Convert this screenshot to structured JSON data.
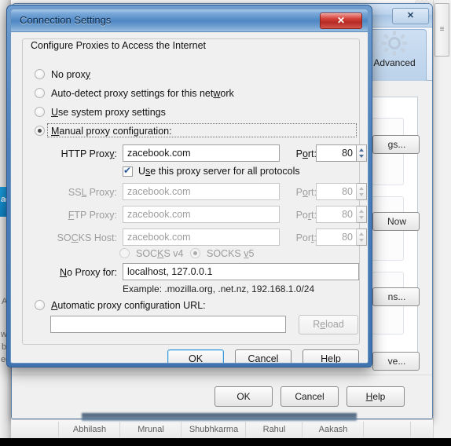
{
  "background_window": {
    "close_label": "✕",
    "tab": {
      "label": "Advanced",
      "icon": "gear-icon"
    },
    "partial_buttons": [
      {
        "name": "settings-button",
        "label": "gs..."
      },
      {
        "name": "check-now-button",
        "label": "Now"
      },
      {
        "name": "exceptions-button",
        "label": "ns..."
      },
      {
        "name": "remove-button",
        "label": "ve..."
      }
    ],
    "footer_buttons": [
      {
        "name": "ok-button",
        "label": "OK"
      },
      {
        "name": "cancel-button",
        "label": "Cancel"
      },
      {
        "name": "help-button",
        "label": "Help",
        "accel": "H"
      }
    ]
  },
  "page_behind": {
    "tab_text": "ac",
    "faint_lines": [
      "A",
      "wh",
      "b",
      "ed"
    ]
  },
  "chatbar": {
    "items": [
      "Abhilash",
      "Mrunal",
      "Shubhkarma",
      "Rahul",
      "Aakash"
    ]
  },
  "dialog": {
    "title": "Connection Settings",
    "close_label": "✕",
    "group_title": "Configure Proxies to Access the Internet",
    "proxy_modes": [
      {
        "label": "No proxy",
        "accel": "y",
        "selected": false
      },
      {
        "label": "Auto-detect proxy settings for this network",
        "accel": "w",
        "selected": false
      },
      {
        "label": "Use system proxy settings",
        "accel": "U",
        "selected": false
      },
      {
        "label": "Manual proxy configuration:",
        "accel": "M",
        "selected": true
      }
    ],
    "fields": [
      {
        "name": "http-proxy",
        "label": "HTTP Proxy:",
        "value": "zacebook.com",
        "port_label": "Port:",
        "port": "80",
        "disabled": false
      },
      {
        "name": "ssl-proxy",
        "label": "SSL Proxy:",
        "value": "zacebook.com",
        "port_label": "Port:",
        "port": "80",
        "disabled": true
      },
      {
        "name": "ftp-proxy",
        "label": "FTP Proxy:",
        "value": "zacebook.com",
        "port_label": "Port:",
        "port": "80",
        "disabled": true
      },
      {
        "name": "socks-host",
        "label": "SOCKS Host:",
        "value": "zacebook.com",
        "port_label": "Port:",
        "port": "80",
        "disabled": true
      }
    ],
    "use_all_protocols": {
      "label": "Use this proxy server for all protocols",
      "checked": true
    },
    "socks_versions": [
      {
        "label": "SOCKS v4",
        "selected": false
      },
      {
        "label": "SOCKS v5",
        "selected": true
      }
    ],
    "no_proxy": {
      "label": "No Proxy for:",
      "value": "localhost, 127.0.0.1",
      "example": "Example: .mozilla.org, .net.nz, 192.168.1.0/24"
    },
    "auto_config": {
      "radio_label": "Automatic proxy configuration URL:",
      "url_value": "",
      "url_placeholder": "",
      "reload_label": "Reload",
      "selected": false
    },
    "buttons": [
      {
        "name": "ok-button",
        "label": "OK",
        "default": true
      },
      {
        "name": "cancel-button",
        "label": "Cancel",
        "default": false
      },
      {
        "name": "help-button",
        "label": "Help",
        "default": false
      }
    ]
  },
  "colors": {
    "title_accent": "#4f87c4",
    "close_red": "#c4372e",
    "focus_blue": "#3c9bd6",
    "disabled_text": "#9d9d9d"
  }
}
